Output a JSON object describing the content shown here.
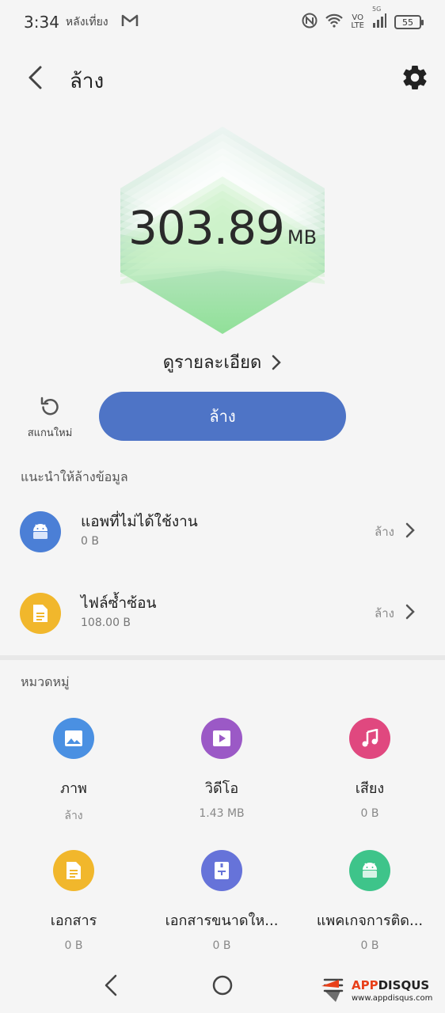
{
  "status_bar": {
    "time": "3:34",
    "period": "หลังเที่ยง",
    "volte_top": "VO",
    "volte_bottom": "LTE",
    "network": "5G",
    "battery": "55"
  },
  "header": {
    "title": "ล้าง"
  },
  "summary": {
    "value": "303.89",
    "unit": "MB",
    "details_label": "ดูรายละเอียด"
  },
  "actions": {
    "rescan_label": "สแกนใหม่",
    "clean_label": "ล้าง"
  },
  "recommend": {
    "section_title": "แนะนำให้ล้างข้อมูล",
    "items": [
      {
        "title": "แอพที่ไม่ได้ใช้งาน",
        "size": "0 B",
        "action": "ล้าง",
        "icon": "android-icon",
        "color": "#4b7fd6"
      },
      {
        "title": "ไฟล์ซ้ำซ้อน",
        "size": "108.00 B",
        "action": "ล้าง",
        "icon": "document-icon",
        "color": "#f1b72c"
      }
    ]
  },
  "categories": {
    "section_title": "หมวดหมู่",
    "items": [
      {
        "name": "ภาพ",
        "size": "ล้าง",
        "icon": "image-icon",
        "color": "#4a90e2"
      },
      {
        "name": "วิดีโอ",
        "size": "1.43 MB",
        "icon": "video-icon",
        "color": "#9b59c6"
      },
      {
        "name": "เสียง",
        "size": "0 B",
        "icon": "music-icon",
        "color": "#e0487f"
      },
      {
        "name": "เอกสาร",
        "size": "0 B",
        "icon": "document-icon",
        "color": "#f1b72c"
      },
      {
        "name": "เอกสารขนาดให...",
        "size": "0 B",
        "icon": "archive-icon",
        "color": "#6673d9"
      },
      {
        "name": "แพคเกจการติด...",
        "size": "0 B",
        "icon": "android-icon",
        "color": "#3ec48a"
      }
    ]
  },
  "watermark": {
    "brand_a": "APP",
    "brand_b": "DISQUS",
    "url": "www.appdisqus.com"
  },
  "colors": {
    "accent": "#4e74c6",
    "hero_top": "#cfe6e2",
    "hero_bottom": "#3fcf4e"
  }
}
